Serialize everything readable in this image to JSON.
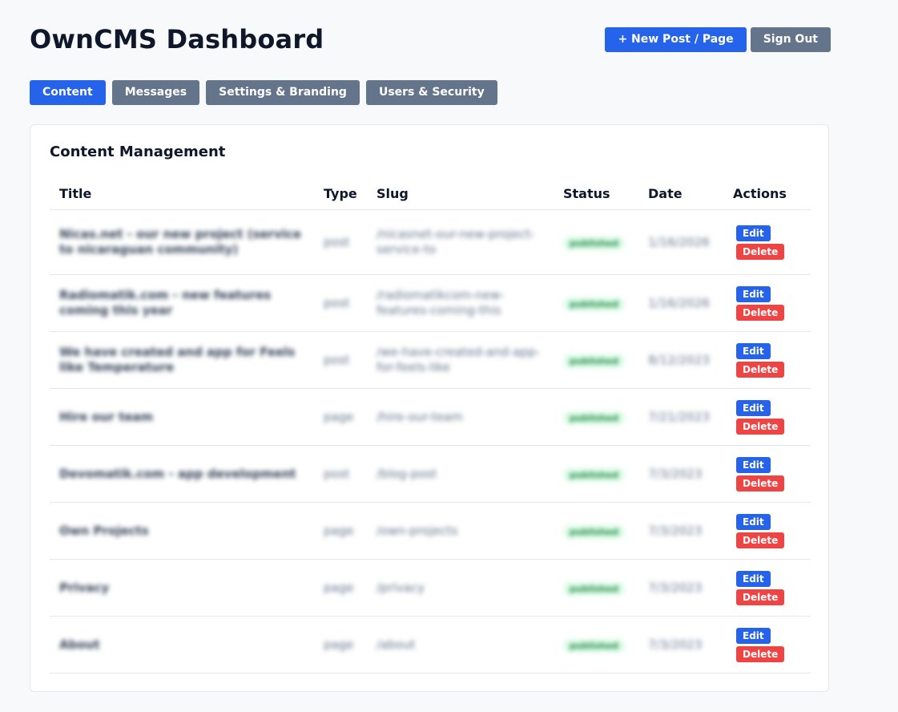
{
  "header": {
    "title": "OwnCMS Dashboard",
    "new_post_label": "+ New Post / Page",
    "sign_out_label": "Sign Out"
  },
  "tabs": [
    {
      "label": "Content",
      "active": true
    },
    {
      "label": "Messages",
      "active": false
    },
    {
      "label": "Settings & Branding",
      "active": false
    },
    {
      "label": "Users & Security",
      "active": false
    }
  ],
  "content": {
    "title": "Content Management",
    "columns": [
      "Title",
      "Type",
      "Slug",
      "Status",
      "Date",
      "Actions"
    ],
    "edit_label": "Edit",
    "delete_label": "Delete",
    "rows": [
      {
        "title": "Nicas.net - our new project (service to nicaraguan community)",
        "type": "post",
        "slug": "/nicasnet-our-new-project-service-to",
        "status": "published",
        "date": "1/16/2026"
      },
      {
        "title": "Radiomatik.com - new features coming this year",
        "type": "post",
        "slug": "/radiomatikcom-new-features-coming-this",
        "status": "published",
        "date": "1/16/2026"
      },
      {
        "title": "We have created and app for Feels like Temperature",
        "type": "post",
        "slug": "/we-have-created-and-app-for-feels-like",
        "status": "published",
        "date": "8/12/2023"
      },
      {
        "title": "Hire our team",
        "type": "page",
        "slug": "/hire-our-team",
        "status": "published",
        "date": "7/21/2023"
      },
      {
        "title": "Devomatik.com - app development",
        "type": "post",
        "slug": "/blog-post",
        "status": "published",
        "date": "7/3/2023"
      },
      {
        "title": "Own Projects",
        "type": "page",
        "slug": "/own-projects",
        "status": "published",
        "date": "7/3/2023"
      },
      {
        "title": "Privacy",
        "type": "page",
        "slug": "/privacy",
        "status": "published",
        "date": "7/3/2023"
      },
      {
        "title": "About",
        "type": "page",
        "slug": "/about",
        "status": "published",
        "date": "7/3/2023"
      }
    ]
  },
  "colors": {
    "primary": "#2563eb",
    "secondary": "#64748b",
    "danger": "#ef4444",
    "success_bg": "#dcfce7"
  }
}
